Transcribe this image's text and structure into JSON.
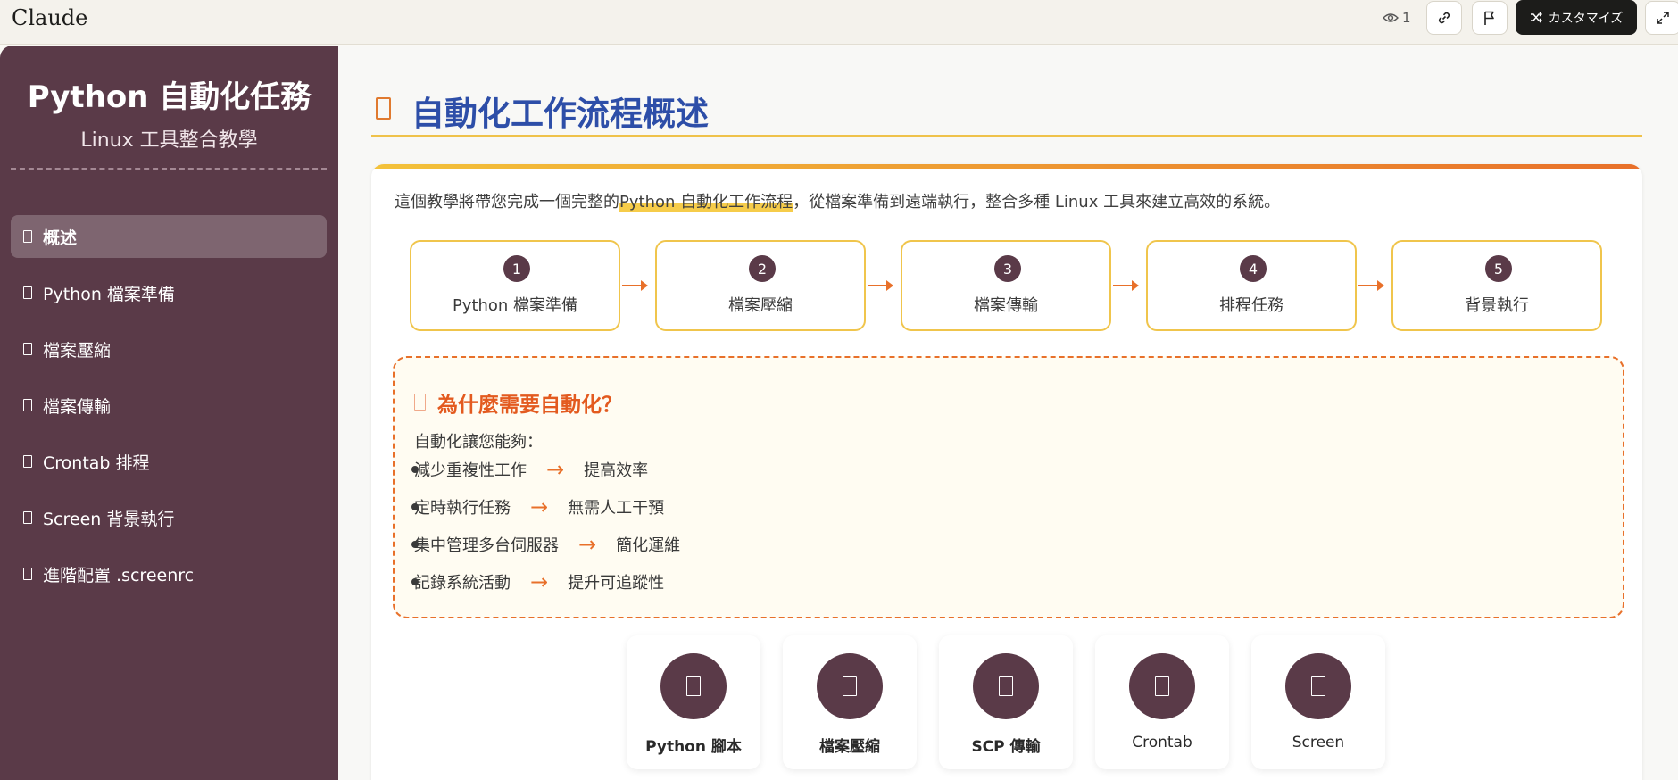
{
  "app": {
    "title": "Claude",
    "viewer_count": "1",
    "customize_label": "カスタマイズ"
  },
  "sidebar": {
    "title": "Python 自動化任務",
    "subtitle": "Linux 工具整合教學",
    "items": [
      {
        "label": "概述",
        "active": true
      },
      {
        "label": "Python 檔案準備",
        "active": false
      },
      {
        "label": "檔案壓縮",
        "active": false
      },
      {
        "label": "檔案傳輸",
        "active": false
      },
      {
        "label": "Crontab 排程",
        "active": false
      },
      {
        "label": "Screen 背景執行",
        "active": false
      },
      {
        "label": "進階配置 .screenrc",
        "active": false
      }
    ]
  },
  "main": {
    "title": "自動化工作流程概述",
    "intro": {
      "before": "這個教學將帶您完成一個完整的",
      "highlight": "Python 自動化工作流程",
      "after": "，從檔案準備到遠端執行，整合多種 Linux 工具來建立高效的系統。"
    },
    "steps": [
      {
        "num": "1",
        "label": "Python 檔案準備"
      },
      {
        "num": "2",
        "label": "檔案壓縮"
      },
      {
        "num": "3",
        "label": "檔案傳輸"
      },
      {
        "num": "4",
        "label": "排程任務"
      },
      {
        "num": "5",
        "label": "背景執行"
      }
    ],
    "why": {
      "title": "為什麼需要自動化？",
      "lead": "自動化讓您能夠：",
      "arrow": "→",
      "items": [
        {
          "from": "減少重複性工作",
          "to": "提高效率"
        },
        {
          "from": "定時執行任務",
          "to": "無需人工干預"
        },
        {
          "from": "集中管理多台伺服器",
          "to": "簡化運維"
        },
        {
          "from": "記錄系統活動",
          "to": "提升可追蹤性"
        }
      ]
    },
    "tools": [
      {
        "label": "Python 腳本"
      },
      {
        "label": "檔案壓縮"
      },
      {
        "label": "SCP 傳輸"
      },
      {
        "label": "Crontab"
      },
      {
        "label": "Screen"
      }
    ]
  },
  "colors": {
    "sidebar_bg": "#5a3a48",
    "title_blue": "#2d4ea8",
    "accent_orange": "#e8702a",
    "accent_yellow": "#f0c54c"
  }
}
